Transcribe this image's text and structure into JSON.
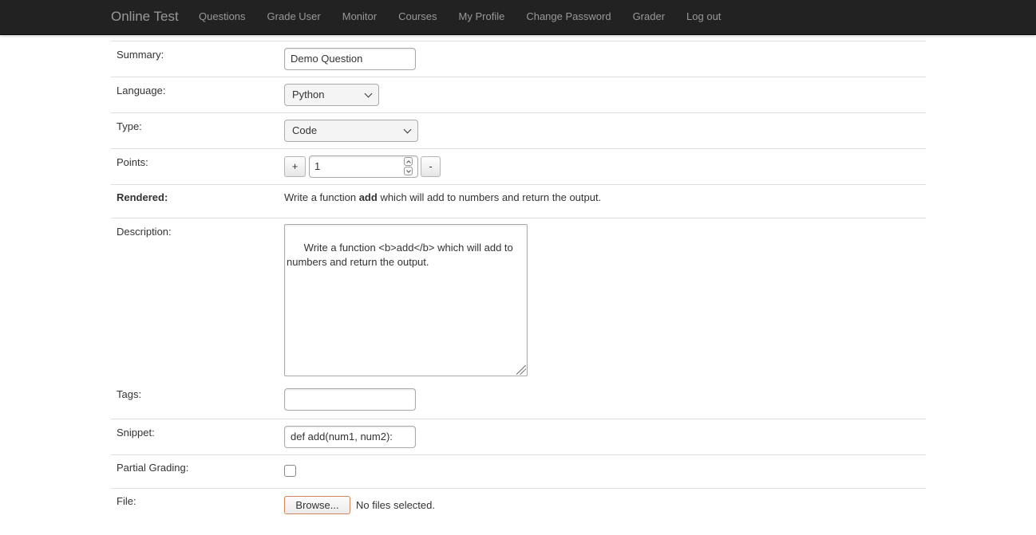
{
  "navbar": {
    "brand": "Online Test",
    "items": [
      "Questions",
      "Grade User",
      "Monitor",
      "Courses",
      "My Profile",
      "Change Password",
      "Grader",
      "Log out"
    ]
  },
  "form": {
    "summary": {
      "label": "Summary:",
      "value": "Demo Question"
    },
    "language": {
      "label": "Language:",
      "selected": "Python"
    },
    "type": {
      "label": "Type:",
      "selected": "Code"
    },
    "points": {
      "label": "Points:",
      "value": "1",
      "plus": "+",
      "minus": "-"
    },
    "rendered": {
      "label": "Rendered:",
      "before": "Write a function ",
      "bold": "add",
      "after": " which will add to numbers and return the output."
    },
    "description": {
      "label": "Description:",
      "value": "Write a function <b>add</b> which will add to numbers and return the output."
    },
    "tags": {
      "label": "Tags:",
      "value": ""
    },
    "snippet": {
      "label": "Snippet:",
      "value": "def add(num1, num2):"
    },
    "partial_grading": {
      "label": "Partial Grading:",
      "checked": false
    },
    "file": {
      "label": "File:",
      "button": "Browse...",
      "status": "No files selected."
    }
  }
}
